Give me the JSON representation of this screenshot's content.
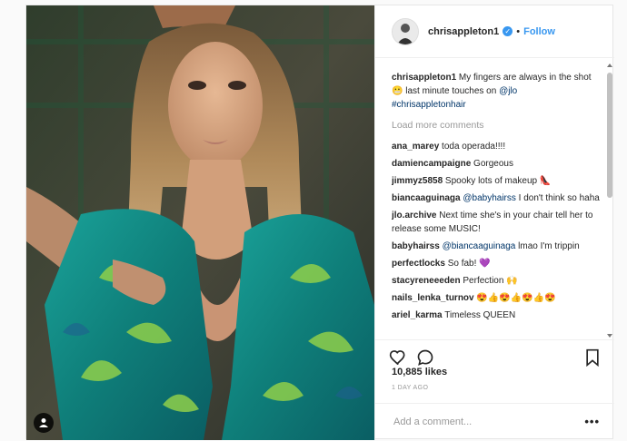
{
  "post": {
    "username": "chrisappleton1",
    "follow_label": "Follow",
    "dot": "•",
    "caption_user": "chrisappleton1",
    "caption_text": " My fingers are always in the shot 😬 last minute touches on ",
    "caption_mention": "@jlo",
    "caption_hashtag": "#chrisappletonhair",
    "load_more": "Load more comments",
    "likes": "10,885 likes",
    "time": "1 DAY AGO",
    "add_comment_placeholder": "Add a comment...",
    "more_label": "•••"
  },
  "comments": [
    {
      "user": "ana_marey",
      "text": " toda operada!!!!",
      "mention": ""
    },
    {
      "user": "damiencampaigne",
      "text": " Gorgeous",
      "mention": ""
    },
    {
      "user": "jimmyz5858",
      "text": " Spooky lots of makeup 👠",
      "mention": ""
    },
    {
      "user": "biancaaguinaga",
      "text": " I don't think so haha",
      "mention": "@babyhairss"
    },
    {
      "user": "jlo.archive",
      "text": " Next time she's in your chair tell her to release some MUSIC!",
      "mention": ""
    },
    {
      "user": "babyhairss",
      "text": " lmao I'm trippin",
      "mention": "@biancaaguinaga"
    },
    {
      "user": "perfectlocks",
      "text": " So fab! 💜",
      "mention": ""
    },
    {
      "user": "stacyreneeeden",
      "text": " Perfection 🙌",
      "mention": ""
    },
    {
      "user": "nails_lenka_turnov",
      "text": " 😍👍😍👍😍👍😍",
      "mention": ""
    },
    {
      "user": "ariel_karma",
      "text": " Timeless QUEEN",
      "mention": ""
    }
  ],
  "icons": {
    "verified": "verified-badge-icon",
    "heart": "heart-icon",
    "comment": "comment-icon",
    "bookmark": "bookmark-icon",
    "user_tag": "user-tag-icon"
  },
  "colors": {
    "link": "#3897f0",
    "mention": "#003569",
    "muted": "#999999",
    "text": "#262626"
  }
}
